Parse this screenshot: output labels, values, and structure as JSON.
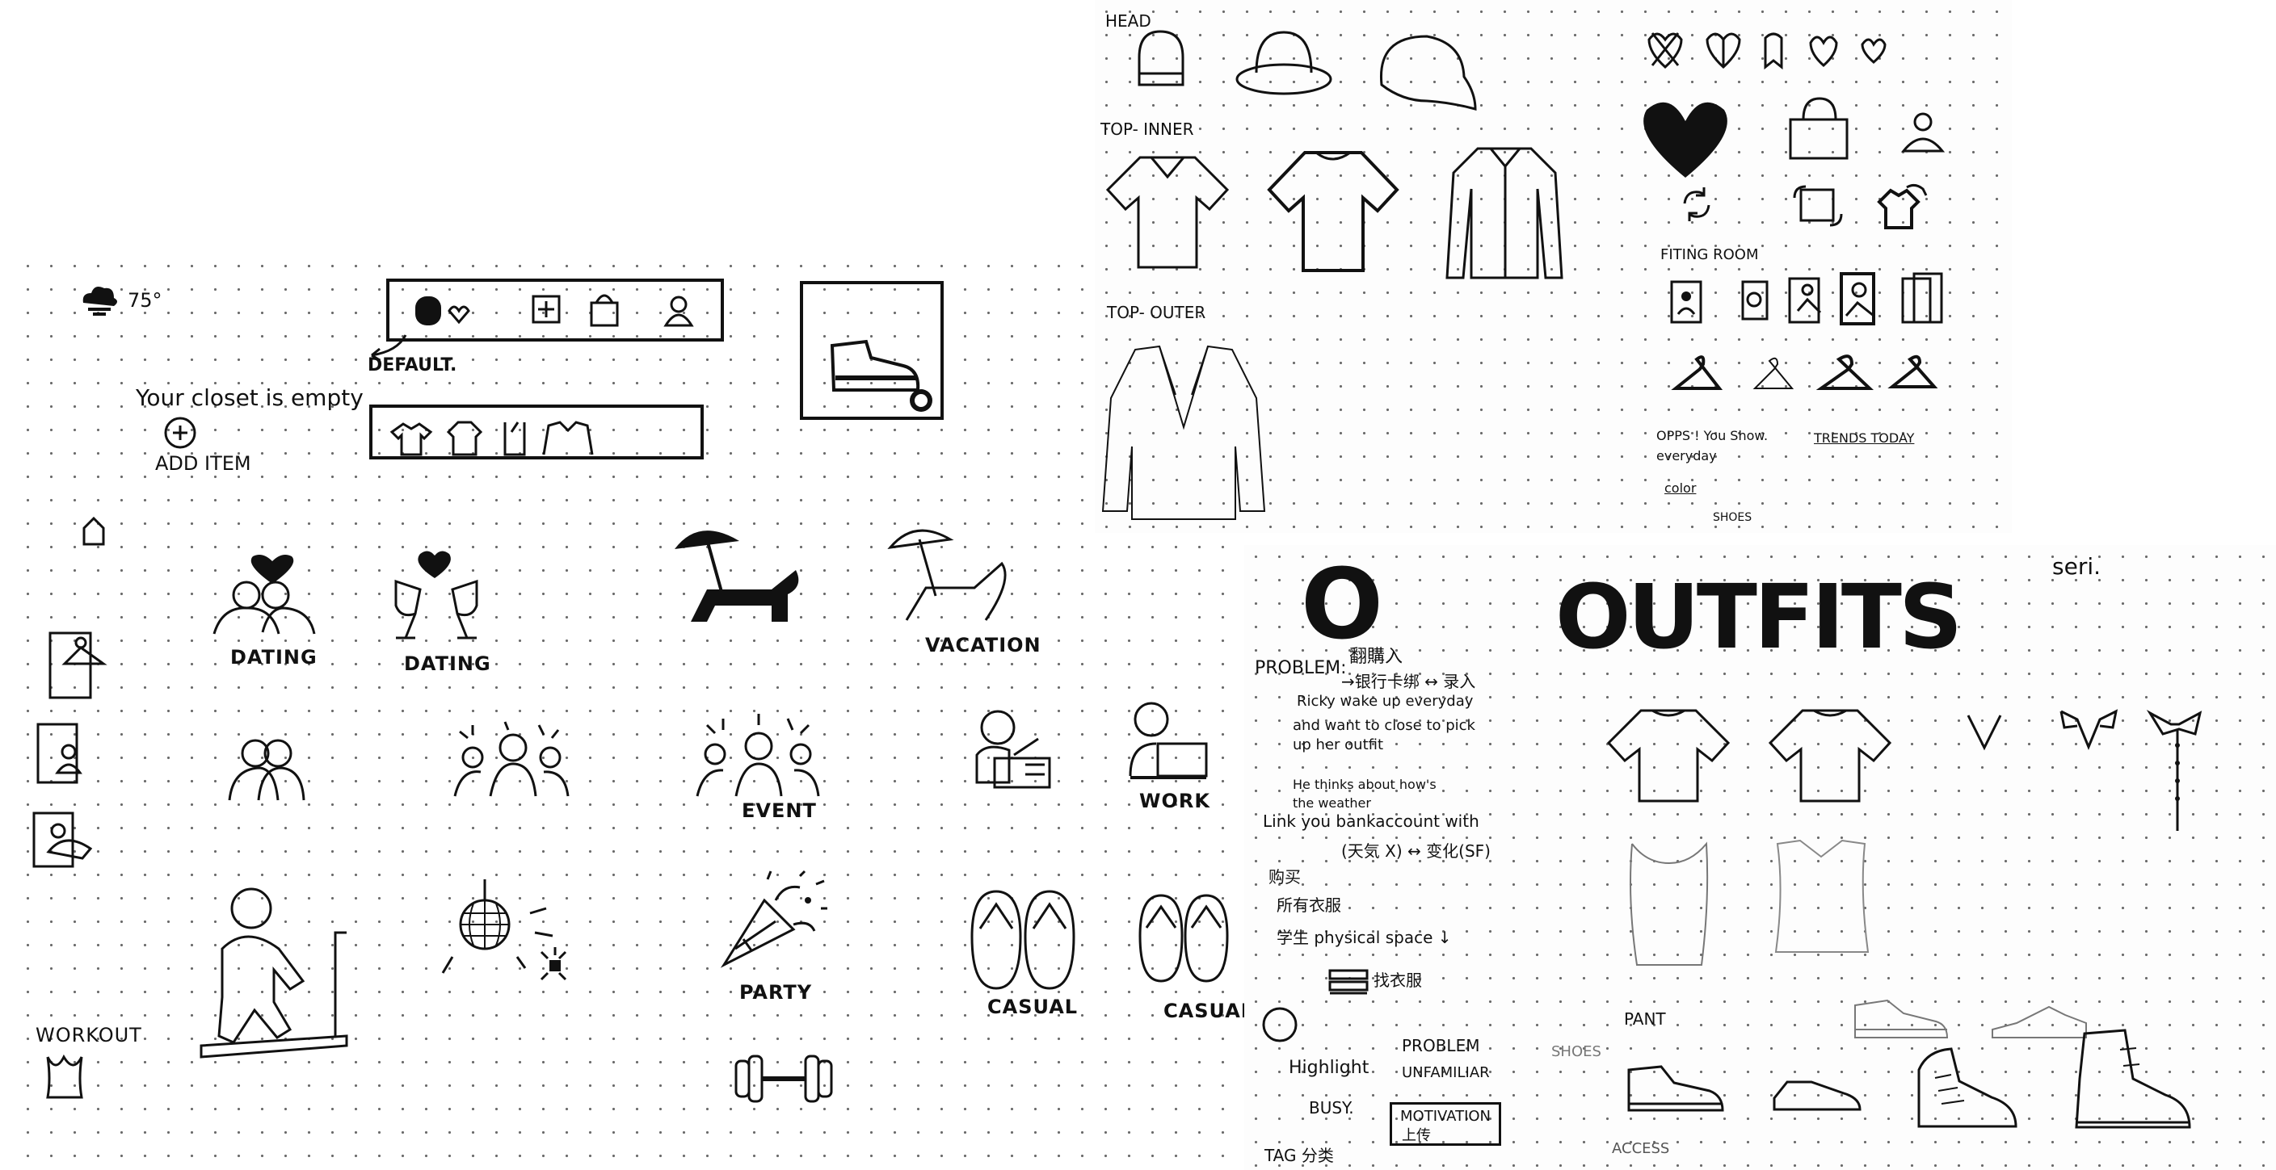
{
  "left_sheet": {
    "weather": {
      "temperature": "75°",
      "icon": "cloud-sun-icon"
    },
    "nav_bar": {
      "default_label": "DEFAULT."
    },
    "empty_state": {
      "message": "Your closet is empty",
      "add_label": "ADD ITEM"
    },
    "category_labels": {
      "dating_1": "DATING",
      "dating_2": "DATING",
      "vacation": "VACATION",
      "event": "EVENT",
      "work": "WORK",
      "party": "PARTY",
      "casual_1": "CASUAL",
      "casual_2": "CASUAI",
      "workout": "WORKOUT"
    }
  },
  "top_right_sheet": {
    "sections": {
      "head": "HEAD",
      "top_inner": "TOP- INNER",
      "top_outer": "TOP- OUTER",
      "fitting_room": "FITING ROOM"
    },
    "notes": {
      "line1": "OPPS ! You Show.",
      "line2": "everyday",
      "line3": "color",
      "line4": "SHOES",
      "trends": "TRENDS TODAY"
    }
  },
  "bottom_right_sheet": {
    "logo_letter": "O",
    "logo_word": "OUTFITS",
    "problem": {
      "label": "PROBLEM:",
      "cn1": "翻購入",
      "line_a": "→银行卡绑 ↔ 录入",
      "line_b": "Ricky  wake up everyday",
      "line_c": "and want to close to pick",
      "line_d": "up her outfit",
      "line_e": "He thinks about how's",
      "line_f": "the weather",
      "line_g": "Link you bankaccount with",
      "line_h": "(天気 X) ↔ 变化(SF)",
      "line_i": "购买",
      "line_j": "所有衣服",
      "line_k": "学生 physical space ↓",
      "line_l": "找衣服",
      "highlight": "Highlight",
      "hl_problem": "PROBLEM",
      "hl_unfamiliar": "UNFAMILIAR",
      "busy": "BUSY.",
      "motivation": "MOTIVATION",
      "motivation_cn": "上传",
      "tag": "TAG 分类"
    },
    "labels": {
      "pant": "PANT",
      "shoes": "SHOES",
      "accessories": "ACCESS",
      "corner": "seri."
    }
  }
}
